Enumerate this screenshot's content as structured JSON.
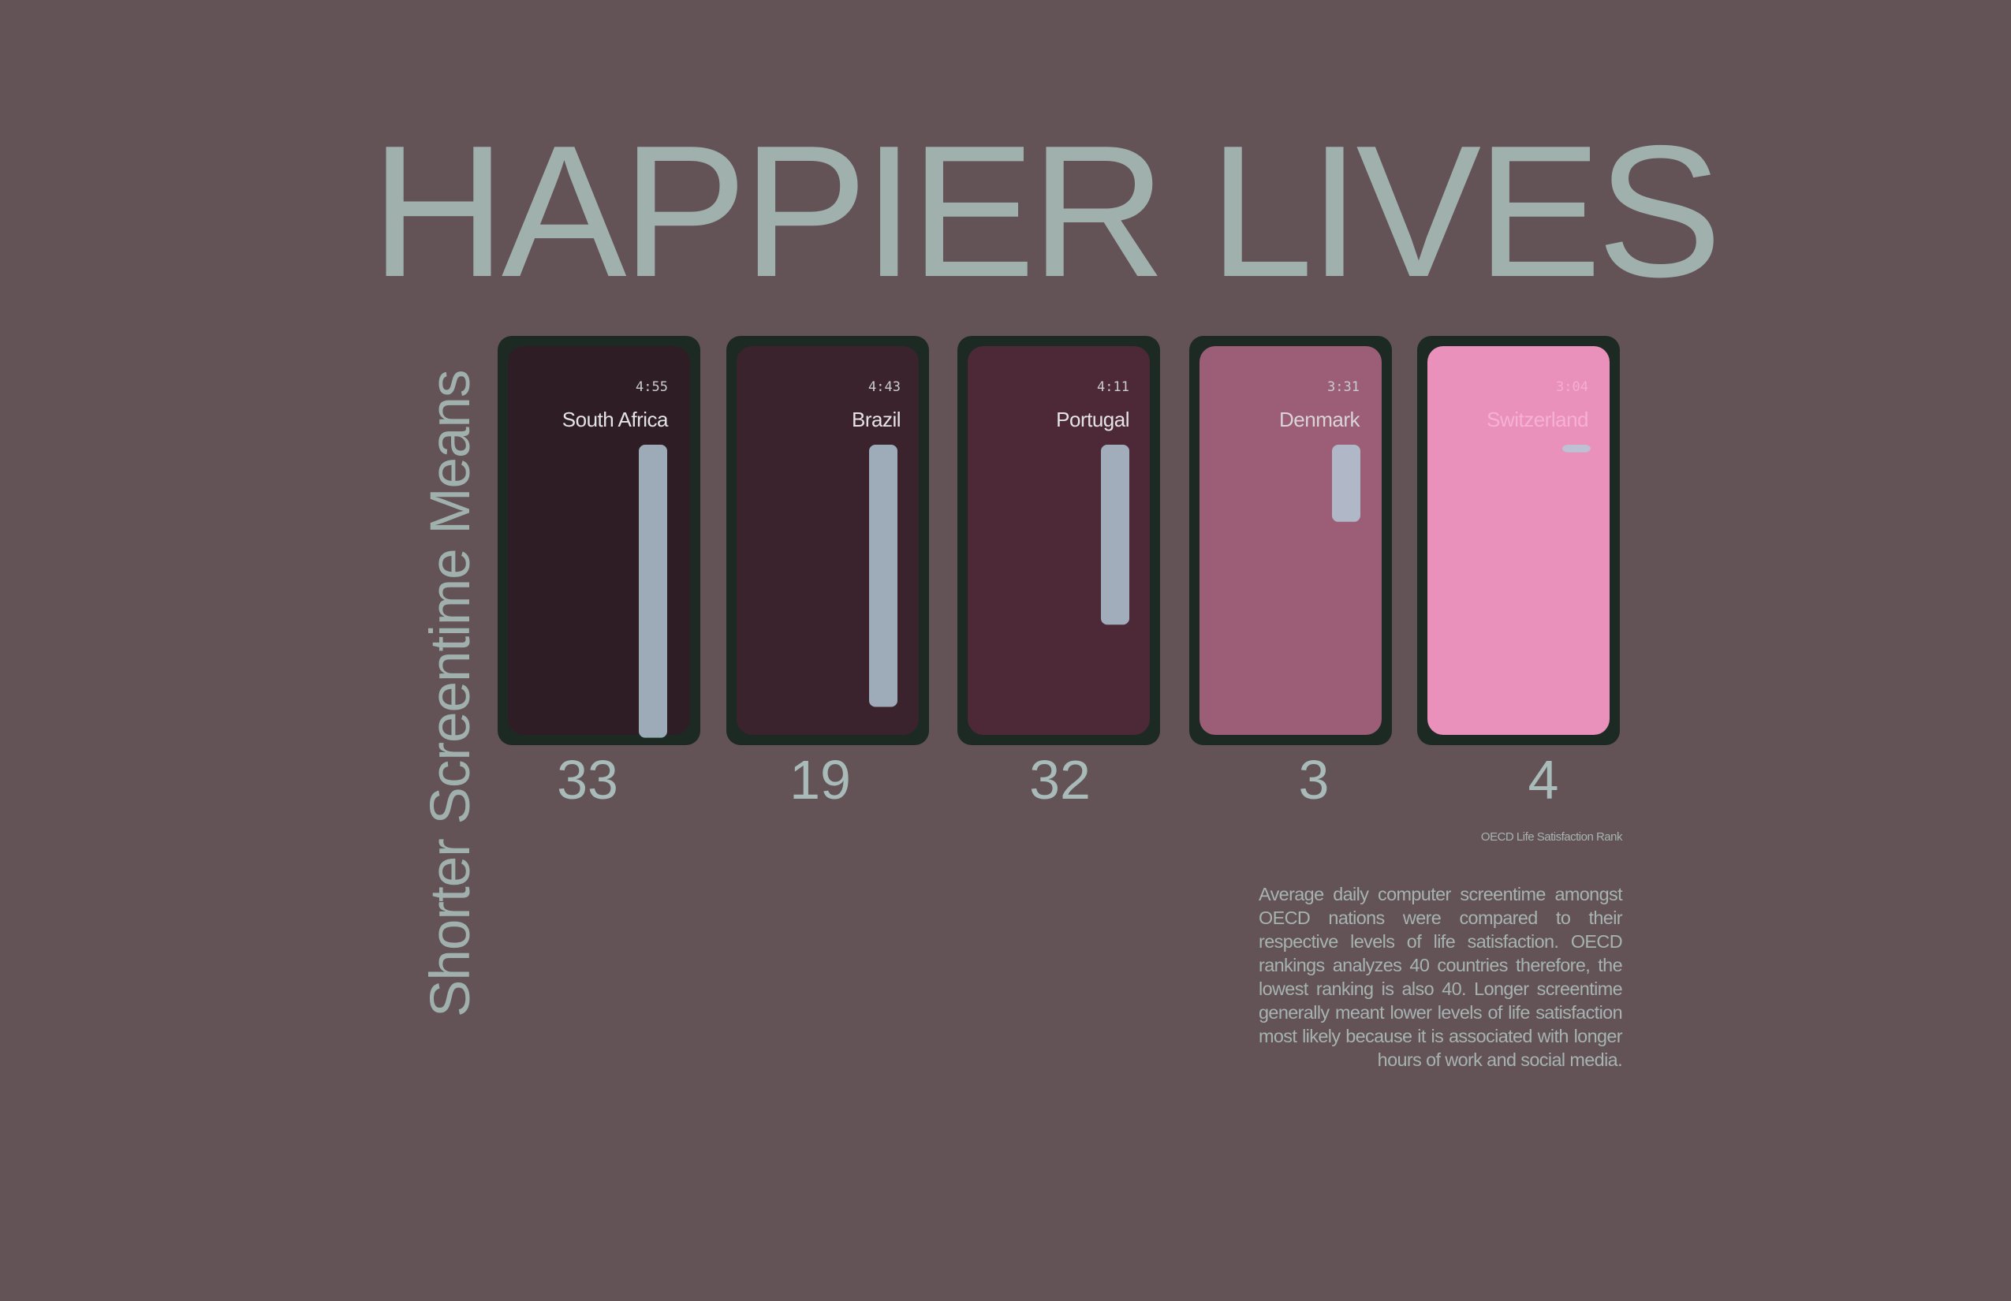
{
  "title": "HAPPIER LIVES",
  "subtitle": "Shorter Screentime Means",
  "rank_label": "OECD Life Satisfaction Rank",
  "description": "Average daily computer screentime amongst OECD nations were compared to their respective levels of life satisfaction. OECD rankings analyzes 40 countries therefore, the lowest ranking is also 40. Longer screentime generally meant lower levels of life satisfaction most likely because it is associated with longer hours of work and social media.",
  "colors": {
    "background": "#635357",
    "text": "#a0b0ad",
    "phone_frame": "#1d2a24",
    "bar": "#b4cbd8"
  },
  "chart_data": {
    "type": "bar",
    "categories": [
      "South Africa",
      "Brazil",
      "Portugal",
      "Denmark",
      "Switzerland"
    ],
    "series": [
      {
        "name": "screentime",
        "values": [
          "4:55",
          "4:43",
          "4:11",
          "3:31",
          "3:04"
        ]
      },
      {
        "name": "OECD Life Satisfaction Rank",
        "values": [
          33,
          19,
          32,
          3,
          4
        ]
      }
    ],
    "screen_colors": [
      "#2e1d24",
      "#3b232d",
      "#4d2937",
      "#9c5e76",
      "#e991bb"
    ],
    "time_text_colors": [
      "#c9cccc",
      "#c9cccc",
      "#c9cccc",
      "#c9cccc",
      "#f5aed0"
    ],
    "name_text_colors": [
      "#e4e4e4",
      "#e4e4e4",
      "#e4e4e4",
      "#d9d4d8",
      "#f6b1d2"
    ],
    "rank_scale": [
      0,
      40
    ]
  }
}
